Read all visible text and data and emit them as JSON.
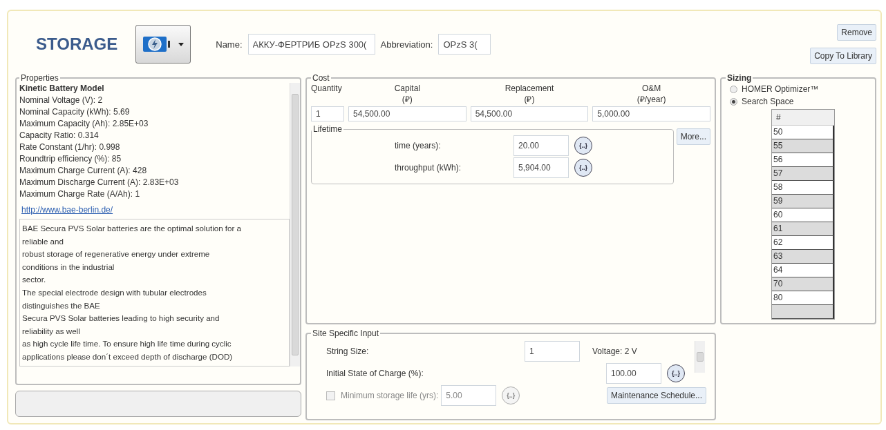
{
  "header": {
    "title": "STORAGE",
    "name_label": "Name:",
    "name_value": "АККУ-ФЕРТРИБ OPzS 300(",
    "abbr_label": "Abbreviation:",
    "abbr_value": "OPzS 3(",
    "buttons": [
      "Remove",
      "Copy To Library"
    ]
  },
  "properties": {
    "title": "Properties",
    "heading": "Kinetic Battery Model",
    "lines": [
      "Nominal Voltage (V): 2",
      "Nominal Capacity (kWh): 5.69",
      "Maximum Capacity (Ah): 2.85E+03",
      "Capacity Ratio: 0.314",
      "Rate Constant (1/hr): 0.998",
      "Roundtrip efficiency (%): 85",
      "Maximum Charge Current (A): 428",
      "Maximum Discharge Current (A): 2.83E+03",
      "Maximum Charge Rate (A/Ah): 1"
    ],
    "link": "http://www.bae-berlin.de/",
    "description": "BAE Secura PVS Solar batteries are the optimal solution for a\nreliable and\nrobust storage of regenerative energy under extreme\nconditions in the industrial\nsector.\nThe special electrode design with tubular electrodes\ndistinguishes the BAE\nSecura PVS Solar batteries leading to high security and\nreliability as well\nas high cycle life time. To ensure high life time during cyclic\napplications please don´t exceed depth of discharge (DOD)"
  },
  "cost": {
    "title": "Cost",
    "columns": [
      {
        "label": "Quantity",
        "value": "1"
      },
      {
        "label": "Capital",
        "unit": "(₽)",
        "value": "54,500.00"
      },
      {
        "label": "Replacement",
        "unit": "(₽)",
        "value": "54,500.00"
      },
      {
        "label": "O&M",
        "unit": "(₽/year)",
        "value": "5,000.00"
      }
    ],
    "lifetime": {
      "title": "Lifetime",
      "rows": [
        {
          "label": "time (years):",
          "value": "20.00",
          "button": "{..}"
        },
        {
          "label": "throughput (kWh):",
          "value": "5,904.00",
          "button": "{..}"
        }
      ]
    },
    "more_button": "More..."
  },
  "sizing": {
    "title": "Sizing",
    "options": [
      {
        "label": "HOMER Optimizer™",
        "selected": false
      },
      {
        "label": "Search Space",
        "selected": true
      }
    ],
    "table_header": "#",
    "rows": [
      "50",
      "55",
      "56",
      "57",
      "58",
      "59",
      "60",
      "61",
      "62",
      "63",
      "64",
      "70",
      "80"
    ]
  },
  "site": {
    "title": "Site Specific Input",
    "string_size_label": "String Size:",
    "string_size_value": "1",
    "voltage": "Voltage:  2 V",
    "soc_label": "Initial State of Charge (%):",
    "soc_value": "100.00",
    "soc_button": "{..}",
    "min_life": {
      "label": "Minimum storage life (yrs):",
      "value": "5.00",
      "button": "{..}",
      "checked": false,
      "disabled": true
    },
    "maintenance_button": "Maintenance Schedule..."
  }
}
